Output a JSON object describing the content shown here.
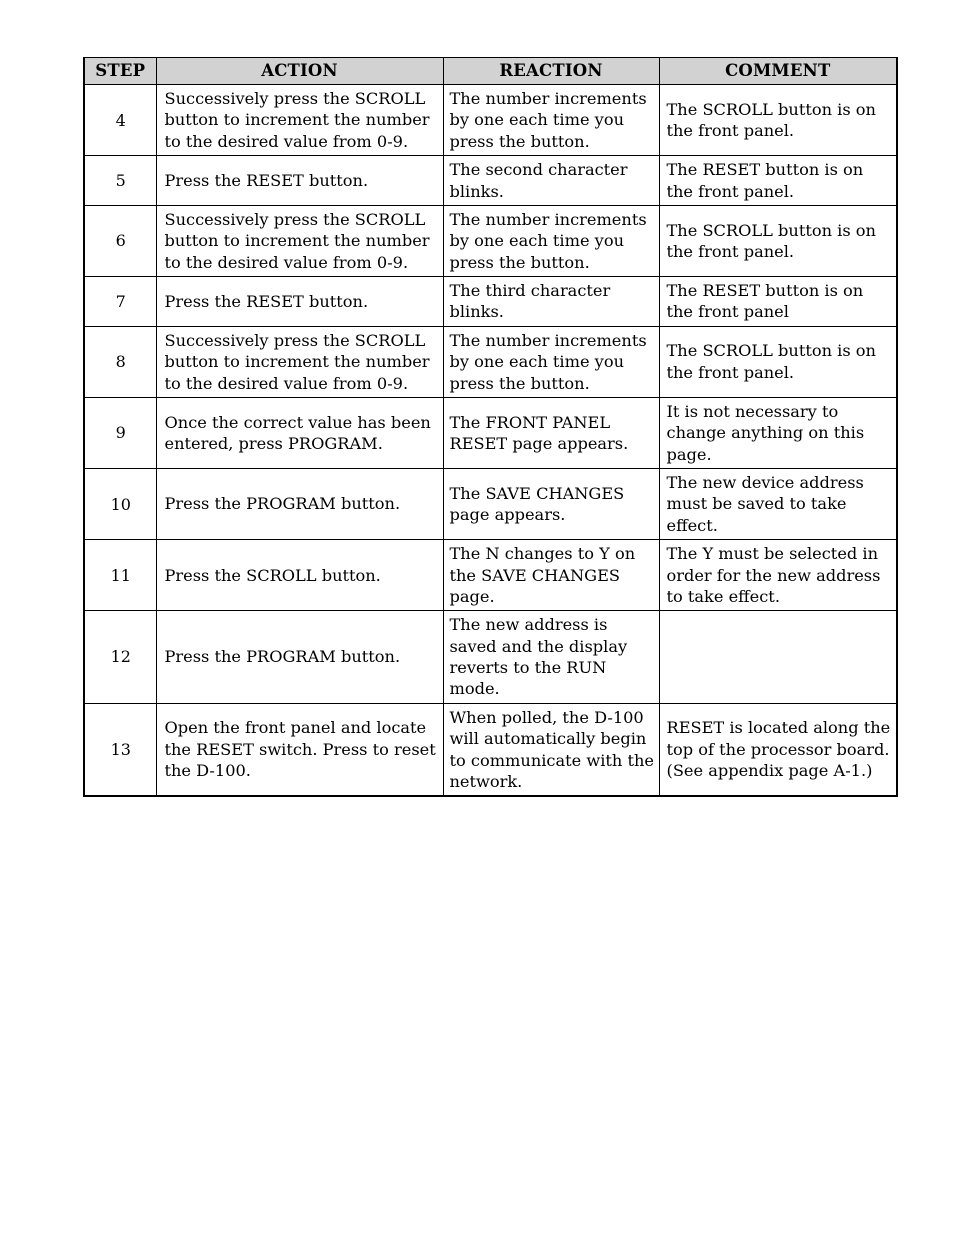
{
  "table": {
    "headers": [
      "STEP",
      "ACTION",
      "REACTION",
      "COMMENT"
    ],
    "header_bg": "#d2d2d2",
    "border_color": "#000000",
    "rows": [
      {
        "step": "4",
        "action": "Successively press the SCROLL button to increment the number to the desired value from 0-9.",
        "reaction": "The number increments by one each time you press the button.",
        "comment": "The SCROLL button is on the front panel."
      },
      {
        "step": "5",
        "action": "Press the RESET button.",
        "reaction": "The second character blinks.",
        "comment": "The RESET button is on the front panel."
      },
      {
        "step": "6",
        "action": "Successively press the SCROLL button to increment the number to the desired value from 0-9.",
        "reaction": "The number increments by one each time you press the button.",
        "comment": "The SCROLL button is on the front panel."
      },
      {
        "step": "7",
        "action": "Press the RESET button.",
        "reaction": "The third character blinks.",
        "comment": "The RESET button is on the front panel"
      },
      {
        "step": "8",
        "action": "Successively press the SCROLL button to increment the number to the desired value from 0-9.",
        "reaction": "The number increments by one each time you press the button.",
        "comment": "The SCROLL button is on the front panel."
      },
      {
        "step": "9",
        "action": "Once the correct value has been entered, press PROGRAM.",
        "reaction": "The FRONT PANEL RESET page appears.",
        "comment": "It is not necessary to change anything on this page."
      },
      {
        "step": "10",
        "action": "Press the PROGRAM button.",
        "reaction": "The SAVE CHANGES page appears.",
        "comment": "The new device address must be saved to take effect."
      },
      {
        "step": "11",
        "action": "Press the SCROLL button.",
        "reaction": "The N changes to Y on the SAVE CHANGES page.",
        "comment": "The Y must be selected in order for the new address to take effect."
      },
      {
        "step": "12",
        "action": "Press the PROGRAM button.",
        "reaction": "The new address is saved and the display reverts to the RUN mode.",
        "comment": ""
      },
      {
        "step": "13",
        "action": "Open the front panel and locate the RESET switch. Press to reset the D-100.",
        "reaction": "When polled, the D-100 will automatically begin to communicate with the network.",
        "comment": "RESET is located along the top of the processor board. (See appendix page A-1.)"
      }
    ]
  }
}
